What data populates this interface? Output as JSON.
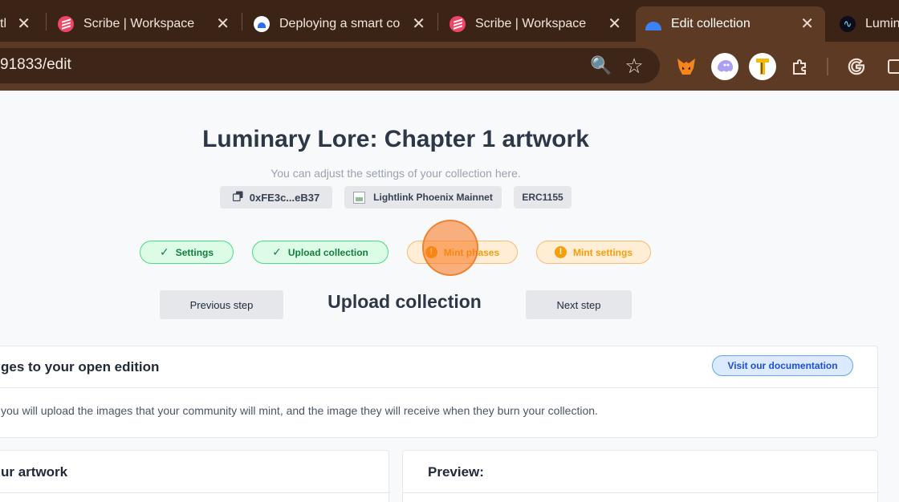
{
  "browser": {
    "tabs": [
      {
        "title": "tl",
        "favicon": "scribe-icon",
        "active": false
      },
      {
        "title": "Scribe | Workspace",
        "favicon": "scribe-icon",
        "active": false
      },
      {
        "title": "Deploying a smart co",
        "favicon": "document-icon",
        "active": false
      },
      {
        "title": "Scribe | Workspace",
        "favicon": "scribe-icon",
        "active": false
      },
      {
        "title": "Edit collection",
        "favicon": "collection-icon",
        "active": true
      },
      {
        "title": "Lumin",
        "favicon": "chart-icon",
        "active": false
      }
    ],
    "url": "91833/edit",
    "zoom_icon": "🔍",
    "star_icon": "☆",
    "close_glyph": "✕"
  },
  "header": {
    "title": "Luminary Lore: Chapter 1 artwork",
    "subtitle": "You can adjust the settings of your collection here."
  },
  "chips": {
    "address": "0xFE3c...eB37",
    "network": "Lightlink Phoenix Mainnet",
    "standard": "ERC1155"
  },
  "steps": [
    {
      "label": "Settings",
      "status": "done"
    },
    {
      "label": "Upload collection",
      "status": "done"
    },
    {
      "label": "Mint phases",
      "status": "warning"
    },
    {
      "label": "Mint settings",
      "status": "warning"
    }
  ],
  "nav": {
    "previous": "Previous step",
    "current": "Upload collection",
    "next": "Next step"
  },
  "upload_card": {
    "title": "ges to your open edition",
    "doc_button": "Visit our documentation",
    "description": "you will upload the images that your community will mint, and the image they will receive when they burn your collection."
  },
  "artwork_card": {
    "title": "ur artwork"
  },
  "preview_card": {
    "title": "Preview:"
  },
  "colors": {
    "chrome_dark": "#3b2416",
    "chrome_toolbar": "#5c3a24",
    "success": "#15803d",
    "warning": "#f59e0b",
    "link": "#1d4ed8"
  }
}
